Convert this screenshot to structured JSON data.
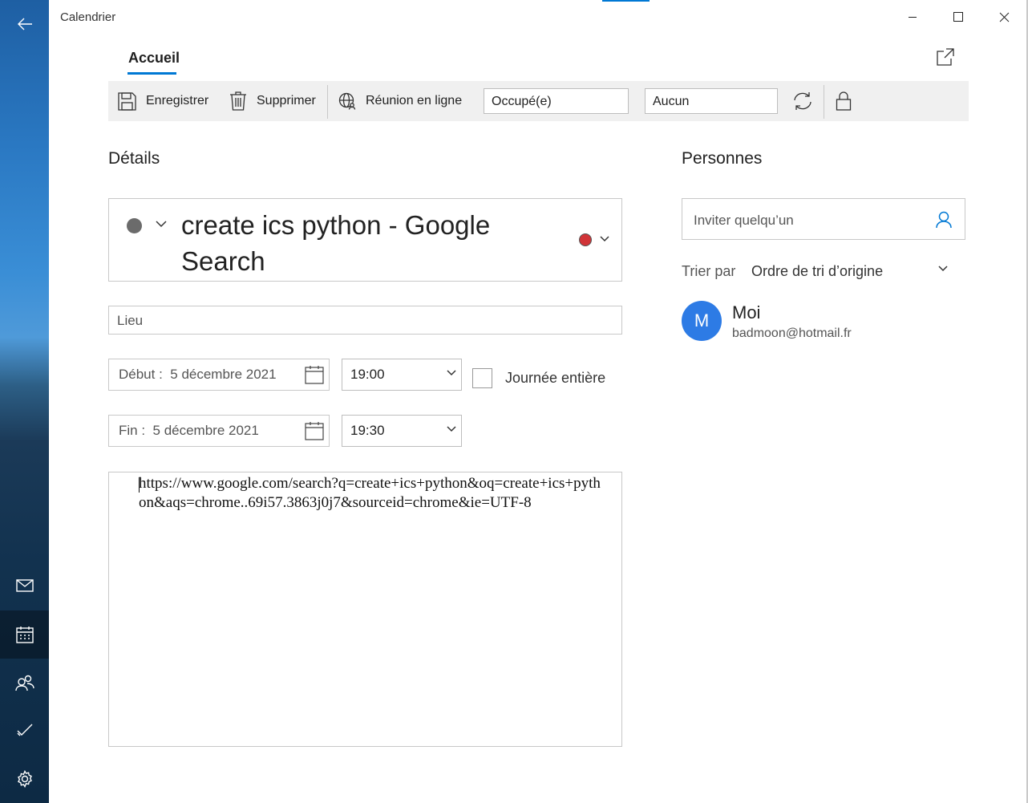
{
  "app": {
    "title": "Calendrier"
  },
  "rail": {
    "back_icon": "back-arrow-icon",
    "items": [
      {
        "name": "mail",
        "icon": "mail-icon"
      },
      {
        "name": "calendar",
        "icon": "calendar-icon",
        "active": true
      },
      {
        "name": "people",
        "icon": "people-icon"
      },
      {
        "name": "todo",
        "icon": "todo-icon"
      },
      {
        "name": "settings",
        "icon": "gear-icon"
      }
    ]
  },
  "tabs": [
    {
      "label": "Accueil",
      "active": true
    }
  ],
  "toolbar": {
    "save_label": "Enregistrer",
    "delete_label": "Supprimer",
    "online_meeting_label": "Réunion en ligne",
    "show_as": "Occupé(e)",
    "reminder": "Aucun"
  },
  "details": {
    "heading": "Détails",
    "subject": "create ics python - Google Search",
    "location_placeholder": "Lieu",
    "start": {
      "label": "Début :",
      "date": "5 décembre 2021",
      "time": "19:00"
    },
    "end": {
      "label": "Fin :",
      "date": "5 décembre 2021",
      "time": "19:30"
    },
    "all_day_label": "Journée entière",
    "notes": "https://www.google.com/search?​q=create+ics+python&oq=create+ics+python&aqs=chrome..69i57.3863j0j7&sourceid=chrome&ie=UTF-8"
  },
  "people": {
    "heading": "Personnes",
    "invite_placeholder": "Inviter quelqu’un",
    "sort_label": "Trier par",
    "sort_value": "Ordre de tri d’origine",
    "attendees": [
      {
        "initial": "M",
        "name": "Moi",
        "email": "badmoon@hotmail.fr"
      }
    ]
  },
  "colors": {
    "accent": "#0078d4",
    "category": "#d13438",
    "avatar": "#2d7be5"
  }
}
